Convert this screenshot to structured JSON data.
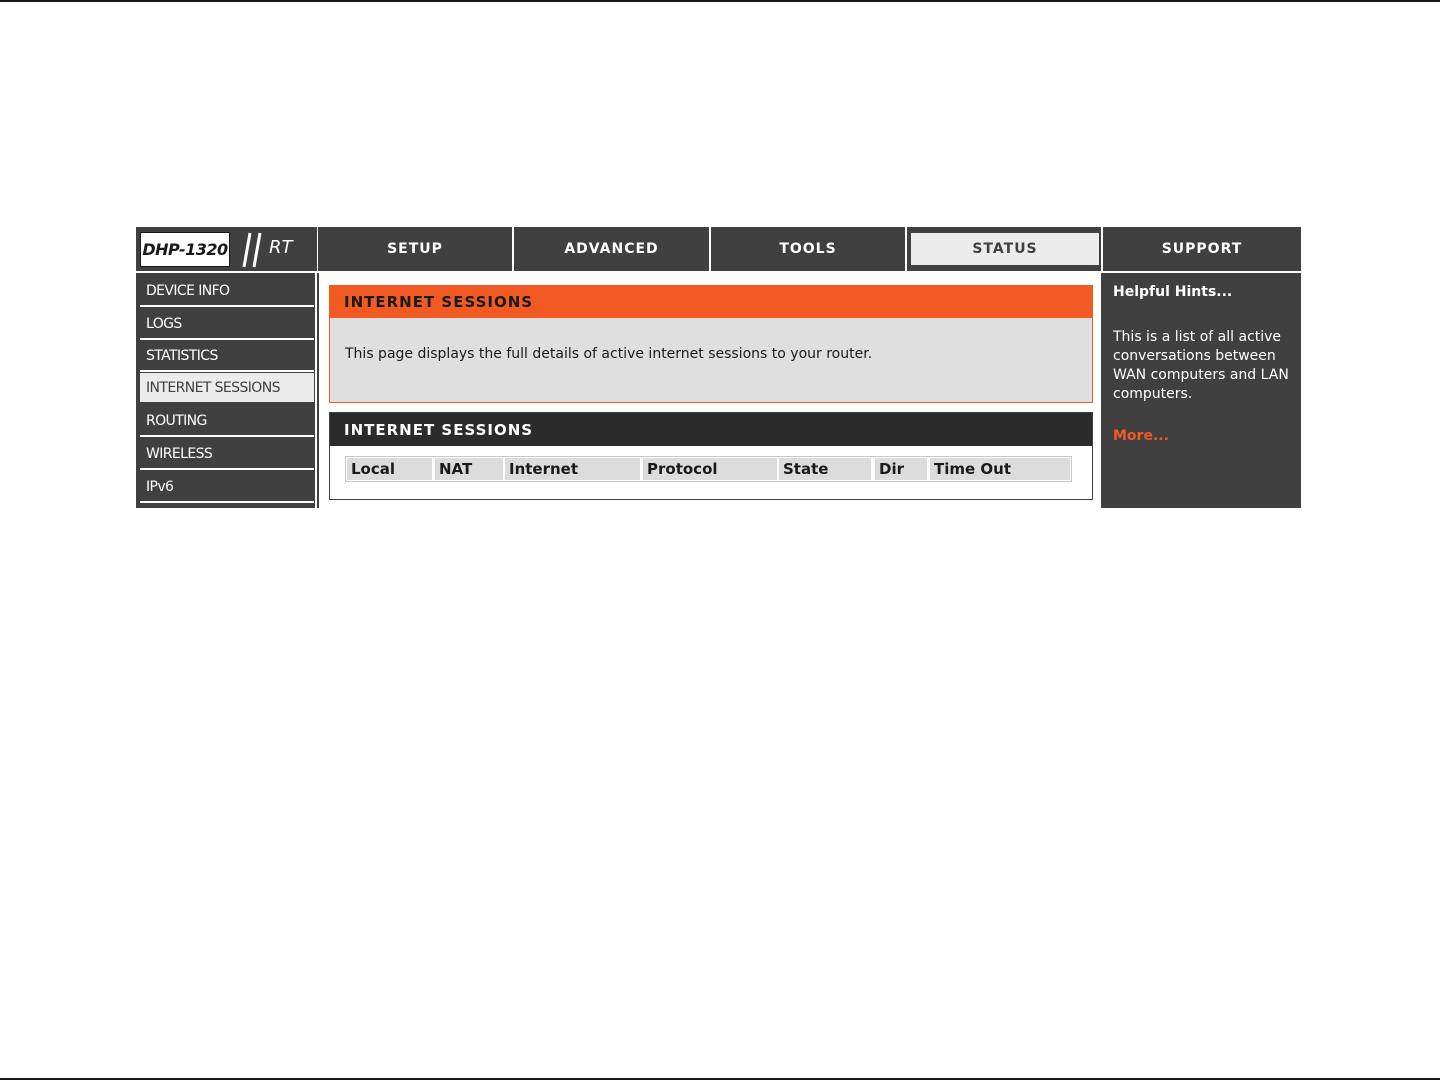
{
  "logo": {
    "model": "DHP-1320",
    "suffix": "RT"
  },
  "tabs": [
    {
      "label": "SETUP",
      "active": false
    },
    {
      "label": "ADVANCED",
      "active": false
    },
    {
      "label": "TOOLS",
      "active": false
    },
    {
      "label": "STATUS",
      "active": true
    },
    {
      "label": "SUPPORT",
      "active": false
    }
  ],
  "sidebar": {
    "items": [
      {
        "label": "DEVICE INFO",
        "active": false
      },
      {
        "label": "LOGS",
        "active": false
      },
      {
        "label": "STATISTICS",
        "active": false
      },
      {
        "label": "INTERNET SESSIONS",
        "active": true
      },
      {
        "label": "ROUTING",
        "active": false
      },
      {
        "label": "WIRELESS",
        "active": false
      },
      {
        "label": "IPv6",
        "active": false
      }
    ]
  },
  "info_panel": {
    "title": "INTERNET SESSIONS",
    "description": "This page displays the full details of active internet sessions to your router."
  },
  "sessions_panel": {
    "title": "INTERNET SESSIONS",
    "columns": [
      "Local",
      "NAT",
      "Internet",
      "Protocol",
      "State",
      "Dir",
      "Time Out"
    ]
  },
  "help": {
    "title": "Helpful Hints...",
    "text": "This is a list of all active conversations between WAN computers and LAN computers.",
    "more": "More..."
  },
  "colors": {
    "accent_orange": "#f15a22",
    "dark_gray": "#404040",
    "panel_gray": "#dfdfdf"
  }
}
